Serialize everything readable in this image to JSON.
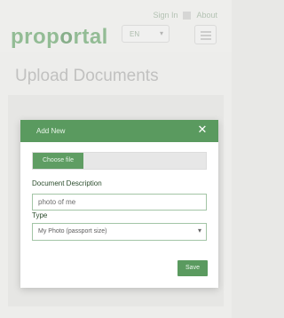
{
  "header": {
    "links": [
      "Sign In",
      "About"
    ],
    "logo_parts": [
      "prop",
      "o",
      "rtal"
    ],
    "language": "EN"
  },
  "page": {
    "title": "Upload Documents"
  },
  "modal": {
    "title": "Add New",
    "choose_file_label": "Choose file",
    "description_label": "Document Description",
    "description_value": "photo of me",
    "type_label": "Type",
    "type_value": "My Photo (passport size)",
    "save_label": "Save"
  },
  "icons": {
    "close": "close-icon",
    "menu": "hamburger-icon",
    "chevron": "chevron-down-icon"
  },
  "colors": {
    "brand": "#5a9a5f",
    "background": "#f2f2f0",
    "text_dark": "#2c4d2d"
  }
}
